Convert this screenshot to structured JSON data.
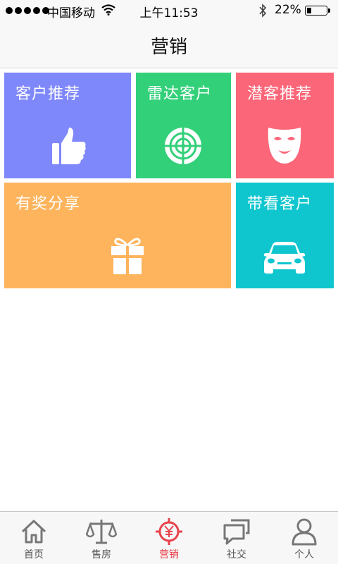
{
  "status_bar": {
    "carrier": "中国移动",
    "time": "上午11:53",
    "battery_percent": "22%",
    "battery_level": 0.22,
    "icons": [
      "signal-dots-icon",
      "wifi-icon",
      "bluetooth-icon",
      "battery-icon"
    ]
  },
  "header": {
    "title": "营销"
  },
  "tiles": [
    {
      "label": "客户推荐",
      "icon": "thumbs-up-icon",
      "color": "#7f88fb"
    },
    {
      "label": "雷达客户",
      "icon": "radar-icon",
      "color": "#33d07a"
    },
    {
      "label": "潜客推荐",
      "icon": "mask-icon",
      "color": "#fb6678"
    },
    {
      "label": "有奖分享",
      "icon": "gift-icon",
      "color": "#fdb45d"
    },
    {
      "label": "带看客户",
      "icon": "car-icon",
      "color": "#0fc6cf"
    }
  ],
  "tabbar": {
    "active_index": 2,
    "active_color": "#e8434b",
    "items": [
      {
        "label": "首页",
        "icon": "home-icon"
      },
      {
        "label": "售房",
        "icon": "scales-icon"
      },
      {
        "label": "营销",
        "icon": "yuan-target-icon"
      },
      {
        "label": "社交",
        "icon": "chat-bubbles-icon"
      },
      {
        "label": "个人",
        "icon": "person-icon"
      }
    ]
  }
}
